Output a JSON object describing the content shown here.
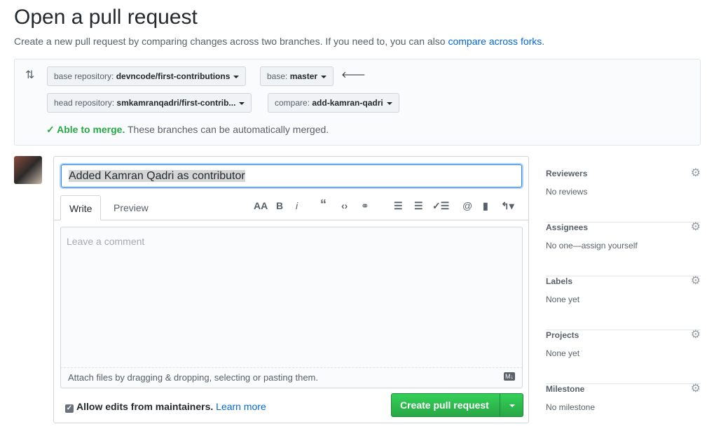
{
  "page": {
    "title": "Open a pull request",
    "subtitle": "Create a new pull request by comparing changes across two branches. If you need to, you can also ",
    "subtitle_link": "compare across forks",
    "subtitle_end": "."
  },
  "range": {
    "base_repo_label": "base repository: ",
    "base_repo": "devncode/first-contributions",
    "base_label": "base: ",
    "base": "master",
    "head_repo_label": "head repository: ",
    "head_repo": "smkamranqadri/first-contrib...",
    "compare_label": "compare: ",
    "compare": "add-kamran-qadri",
    "merge_status": "Able to merge.",
    "merge_text": " These branches can be automatically merged."
  },
  "form": {
    "title_value": "Added Kamran Qadri as contributor",
    "tabs": [
      "Write",
      "Preview"
    ],
    "placeholder": "Leave a comment",
    "attach": "Attach files by dragging & dropping, selecting or pasting them.",
    "allow_edits": "Allow edits from maintainers.",
    "learn_more": "Learn more",
    "create": "Create pull request"
  },
  "toolbar": [
    "header-icon",
    "bold-icon",
    "italic-icon",
    "quote-icon",
    "code-icon",
    "link-icon",
    "bullet-list-icon",
    "numbered-list-icon",
    "task-list-icon",
    "mention-icon",
    "saved-reply-icon",
    "reply-icon"
  ],
  "sidebar": [
    {
      "label": "Reviewers",
      "value": "No reviews"
    },
    {
      "label": "Assignees",
      "value": "No one—assign yourself"
    },
    {
      "label": "Labels",
      "value": "None yet"
    },
    {
      "label": "Projects",
      "value": "None yet"
    },
    {
      "label": "Milestone",
      "value": "No milestone"
    }
  ],
  "colors": {
    "accent": "#0366d6",
    "success": "#28a745"
  }
}
